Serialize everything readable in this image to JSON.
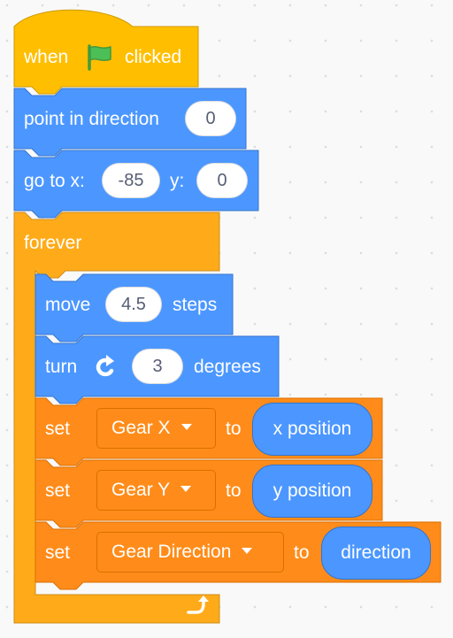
{
  "colors": {
    "events": "#ffbf00",
    "control": "#ffab19",
    "motion": "#4c97ff",
    "variables": "#ff8c1a",
    "flag": "#4cbf56"
  },
  "script": {
    "hat": {
      "word_when": "when",
      "icon": "green-flag-icon",
      "word_clicked": "clicked"
    },
    "point_direction": {
      "label": "point in direction",
      "value": "0"
    },
    "go_to": {
      "label_x": "go to x:",
      "x_value": "-85",
      "label_y": "y:",
      "y_value": "0"
    },
    "forever": {
      "label": "forever",
      "loop_icon": "loop-arrow-icon"
    },
    "move": {
      "label": "move",
      "value": "4.5",
      "unit": "steps"
    },
    "turn": {
      "label": "turn",
      "icon": "rotate-clockwise-icon",
      "value": "3",
      "unit": "degrees"
    },
    "set_gear_x": {
      "label": "set",
      "variable": "Gear X",
      "to": "to",
      "reporter": "x position"
    },
    "set_gear_y": {
      "label": "set",
      "variable": "Gear Y",
      "to": "to",
      "reporter": "y position"
    },
    "set_gear_dir": {
      "label": "set",
      "variable": "Gear Direction",
      "to": "to",
      "reporter": "direction"
    }
  }
}
